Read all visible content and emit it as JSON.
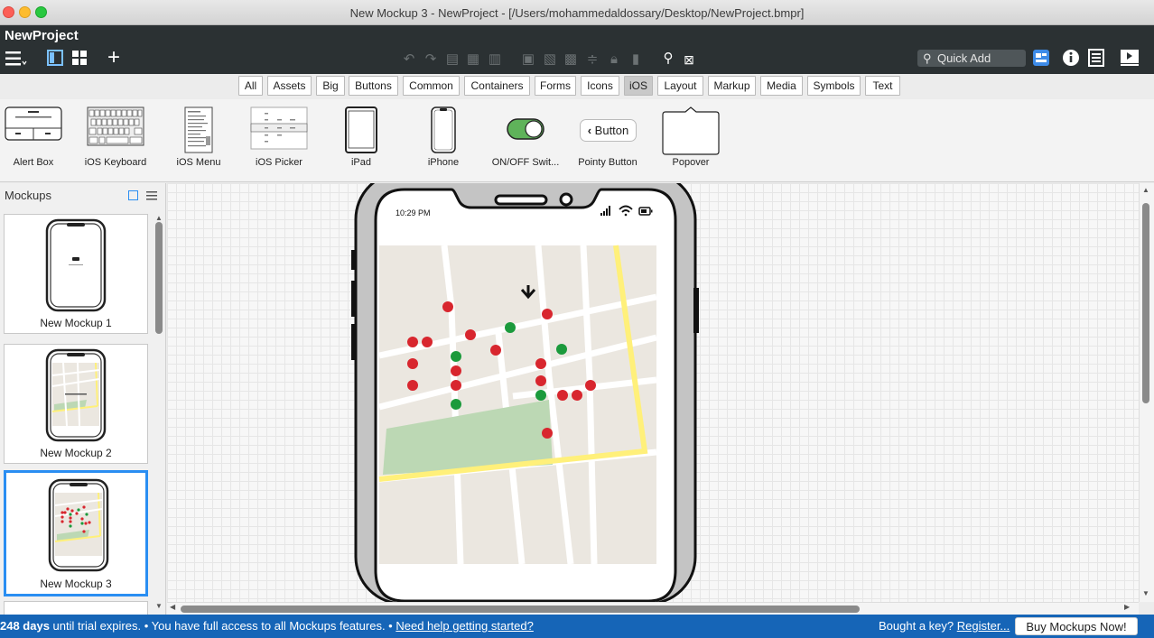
{
  "window": {
    "title": "New Mockup 3 - NewProject - [/Users/mohammedaldossary/Desktop/NewProject.bmpr]"
  },
  "app": {
    "project_name": "NewProject"
  },
  "toolbar": {
    "quick_add_placeholder": "Quick Add"
  },
  "categories": [
    "All",
    "Assets",
    "Big",
    "Buttons",
    "Common",
    "Containers",
    "Forms",
    "Icons",
    "iOS",
    "Layout",
    "Markup",
    "Media",
    "Symbols",
    "Text"
  ],
  "active_category": "iOS",
  "assets": [
    {
      "label": "Alert Box"
    },
    {
      "label": "iOS Keyboard"
    },
    {
      "label": "iOS Menu"
    },
    {
      "label": "iOS Picker"
    },
    {
      "label": "iPad"
    },
    {
      "label": "iPhone"
    },
    {
      "label": "ON/OFF Swit..."
    },
    {
      "label": "Pointy Button",
      "button_text": "Button"
    },
    {
      "label": "Popover"
    }
  ],
  "mockups_panel": {
    "title": "Mockups",
    "items": [
      {
        "label": "New Mockup 1"
      },
      {
        "label": "New Mockup 2"
      },
      {
        "label": "New Mockup 3",
        "selected": true
      }
    ]
  },
  "phone": {
    "time": "10:29 PM"
  },
  "status": {
    "trial_days": "248 days",
    "trial_text": " until trial expires. • You have full access to all Mockups features. • ",
    "help_link": "Need help getting started?",
    "key_text": "Bought a key? ",
    "register_link": "Register...",
    "buy_button": "Buy Mockups Now!"
  },
  "colors": {
    "accent": "#1665b7",
    "selection": "#2a8ef2",
    "marker_red": "#d8262e",
    "marker_green": "#1b9a3c",
    "map_road_yellow": "#fff07a",
    "map_park": "#bcd8b4"
  }
}
